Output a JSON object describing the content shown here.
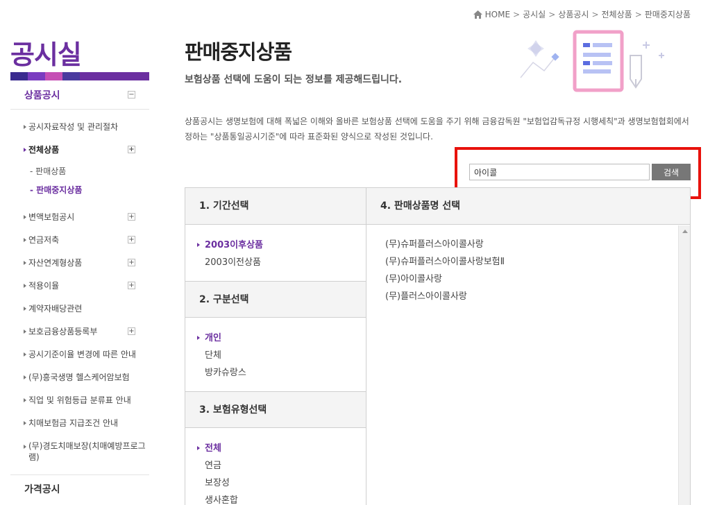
{
  "breadcrumb": {
    "home": "HOME",
    "items": [
      "공시실",
      "상품공시",
      "전체상품",
      "판매중지상품"
    ]
  },
  "sidebar": {
    "title": "공시실",
    "head": "상품공시",
    "items": [
      {
        "label": "공시자료작성 및 관리절차"
      },
      {
        "label": "전체상품",
        "toggle": "+"
      },
      {
        "sub1": "판매상품",
        "sub2": "판매중지상품"
      },
      {
        "label": "변액보험공시",
        "toggle": "+"
      },
      {
        "label": "연금저축",
        "toggle": "+"
      },
      {
        "label": "자산연계형상품",
        "toggle": "+"
      },
      {
        "label": "적용이율",
        "toggle": "+"
      },
      {
        "label": "계약자배당관련"
      },
      {
        "label": "보호금융상품등록부",
        "toggle": "+"
      },
      {
        "label": "공시기준이율 변경에 따른 안내"
      },
      {
        "label": "(무)흥국생명 헬스케어암보험"
      },
      {
        "label": "직업 및 위험등급 분류표 안내"
      },
      {
        "label": "치매보험금 지급조건 안내"
      },
      {
        "label": "(무)경도치매보장(치매예방프로그램)"
      }
    ],
    "bottom": "가격공시",
    "minus": "−"
  },
  "main": {
    "title": "판매중지상품",
    "subtitle": "보험상품 선택에 도움이 되는 정보를 제공해드립니다.",
    "description": "상품공시는 생명보험에 대해 폭넓은 이해와 올바른 보험상품 선택에 도움을 주기 위해 금융감독원 \"보험업감독규정 시행세칙\"과 생명보험협회에서 정하는 \"상품통일공시기준\"에 따라 표준화된 양식으로 작성된 것입니다."
  },
  "search": {
    "value": "아이콜",
    "button": "검색"
  },
  "sections": {
    "period": {
      "title": "1. 기간선택",
      "options": [
        "2003이후상품",
        "2003이전상품"
      ]
    },
    "category": {
      "title": "2. 구분선택",
      "options": [
        "개인",
        "단체",
        "방카슈랑스"
      ]
    },
    "type": {
      "title": "3. 보험유형선택",
      "options": [
        "전체",
        "연금",
        "보장성",
        "생사혼합"
      ]
    },
    "products": {
      "title": "4. 판매상품명 선택",
      "items": [
        "(무)슈퍼플러스아이콜사랑",
        "(무)슈퍼플러스아이콜사랑보험Ⅱ",
        "(무)아이콜사랑",
        "(무)플러스아이콜사랑"
      ]
    }
  },
  "colors": {
    "brand": "#6b2fa0",
    "highlight": "#e8120c"
  }
}
